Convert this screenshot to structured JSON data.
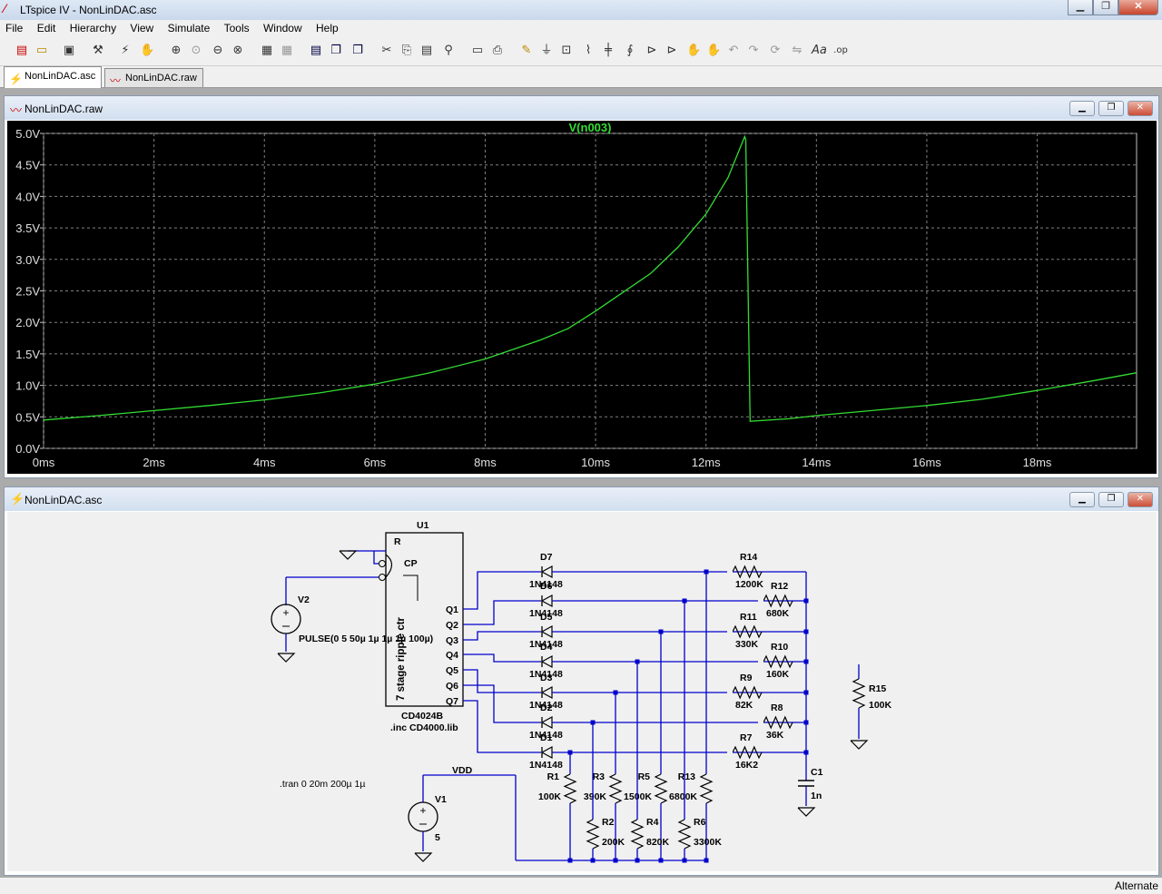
{
  "app": {
    "title": "LTspice IV - NonLinDAC.asc",
    "logo": "LT"
  },
  "menu": [
    "File",
    "Edit",
    "Hierarchy",
    "View",
    "Simulate",
    "Tools",
    "Window",
    "Help"
  ],
  "tabs": [
    {
      "label": "NonLinDAC.asc",
      "icon": "schematic-icon"
    },
    {
      "label": "NonLinDAC.raw",
      "icon": "waveform-icon"
    }
  ],
  "waveform_window": {
    "title": "NonLinDAC.raw"
  },
  "schematic_window": {
    "title": "NonLinDAC.asc"
  },
  "status": {
    "mode": "Alternate"
  },
  "colors": {
    "trace": "#33dd33",
    "grid": "#808080",
    "background": "#000000",
    "wire": "#0000cc",
    "component": "#000000"
  },
  "chart_data": {
    "type": "line",
    "title": "V(n003)",
    "xlabel": "",
    "ylabel": "",
    "xlim": [
      0,
      19.8
    ],
    "ylim": [
      0,
      5.0
    ],
    "x_ticks": [
      "0ms",
      "2ms",
      "4ms",
      "6ms",
      "8ms",
      "10ms",
      "12ms",
      "14ms",
      "16ms",
      "18ms"
    ],
    "y_ticks": [
      "0.0V",
      "0.5V",
      "1.0V",
      "1.5V",
      "2.0V",
      "2.5V",
      "3.0V",
      "3.5V",
      "4.0V",
      "4.5V",
      "5.0V"
    ],
    "grid": true,
    "series": [
      {
        "name": "V(n003)",
        "x": [
          0,
          1,
          2,
          3,
          4,
          5,
          6,
          7,
          8,
          9,
          9.5,
          10,
          11,
          11.5,
          12,
          12.4,
          12.7,
          12.72,
          12.8,
          13.5,
          14,
          15,
          16,
          17,
          18,
          19,
          19.8
        ],
        "y": [
          0.45,
          0.52,
          0.6,
          0.68,
          0.77,
          0.88,
          1.02,
          1.2,
          1.42,
          1.72,
          1.9,
          2.18,
          2.78,
          3.2,
          3.72,
          4.3,
          4.95,
          4.9,
          0.43,
          0.47,
          0.52,
          0.6,
          0.68,
          0.78,
          0.92,
          1.07,
          1.2
        ]
      }
    ]
  },
  "schematic": {
    "components": [
      {
        "ref": "U1",
        "value": "CD4024B",
        "note": ".inc CD4000.lib",
        "body": "7 stage ripple ctr",
        "pins": [
          "R",
          "CP",
          "Q1",
          "Q2",
          "Q3",
          "Q4",
          "Q5",
          "Q6",
          "Q7"
        ]
      },
      {
        "ref": "V2",
        "value": "PULSE(0 5 50µ 1µ 1µ 1µ 100µ)"
      },
      {
        "ref": "V1",
        "value": "5"
      },
      {
        "ref": "C1",
        "value": "1n"
      },
      {
        "ref": "R15",
        "value": "100K"
      },
      {
        "ref": "D7",
        "value": "1N4148"
      },
      {
        "ref": "D6",
        "value": "1N4148"
      },
      {
        "ref": "D5",
        "value": "1N4148"
      },
      {
        "ref": "D4",
        "value": "1N4148"
      },
      {
        "ref": "D3",
        "value": "1N4148"
      },
      {
        "ref": "D2",
        "value": "1N4148"
      },
      {
        "ref": "D1",
        "value": "1N4148"
      },
      {
        "ref": "R14",
        "value": "1200K"
      },
      {
        "ref": "R12",
        "value": "680K"
      },
      {
        "ref": "R11",
        "value": "330K"
      },
      {
        "ref": "R10",
        "value": "160K"
      },
      {
        "ref": "R9",
        "value": "82K"
      },
      {
        "ref": "R8",
        "value": "36K"
      },
      {
        "ref": "R7",
        "value": "16K2"
      },
      {
        "ref": "R1",
        "value": "100K"
      },
      {
        "ref": "R2",
        "value": "200K"
      },
      {
        "ref": "R3",
        "value": "390K"
      },
      {
        "ref": "R4",
        "value": "820K"
      },
      {
        "ref": "R5",
        "value": "1500K"
      },
      {
        "ref": "R6",
        "value": "3300K"
      },
      {
        "ref": "R13",
        "value": "6800K"
      }
    ],
    "net_label": "VDD",
    "directive": ".tran 0 20m 200µ 1µ"
  }
}
